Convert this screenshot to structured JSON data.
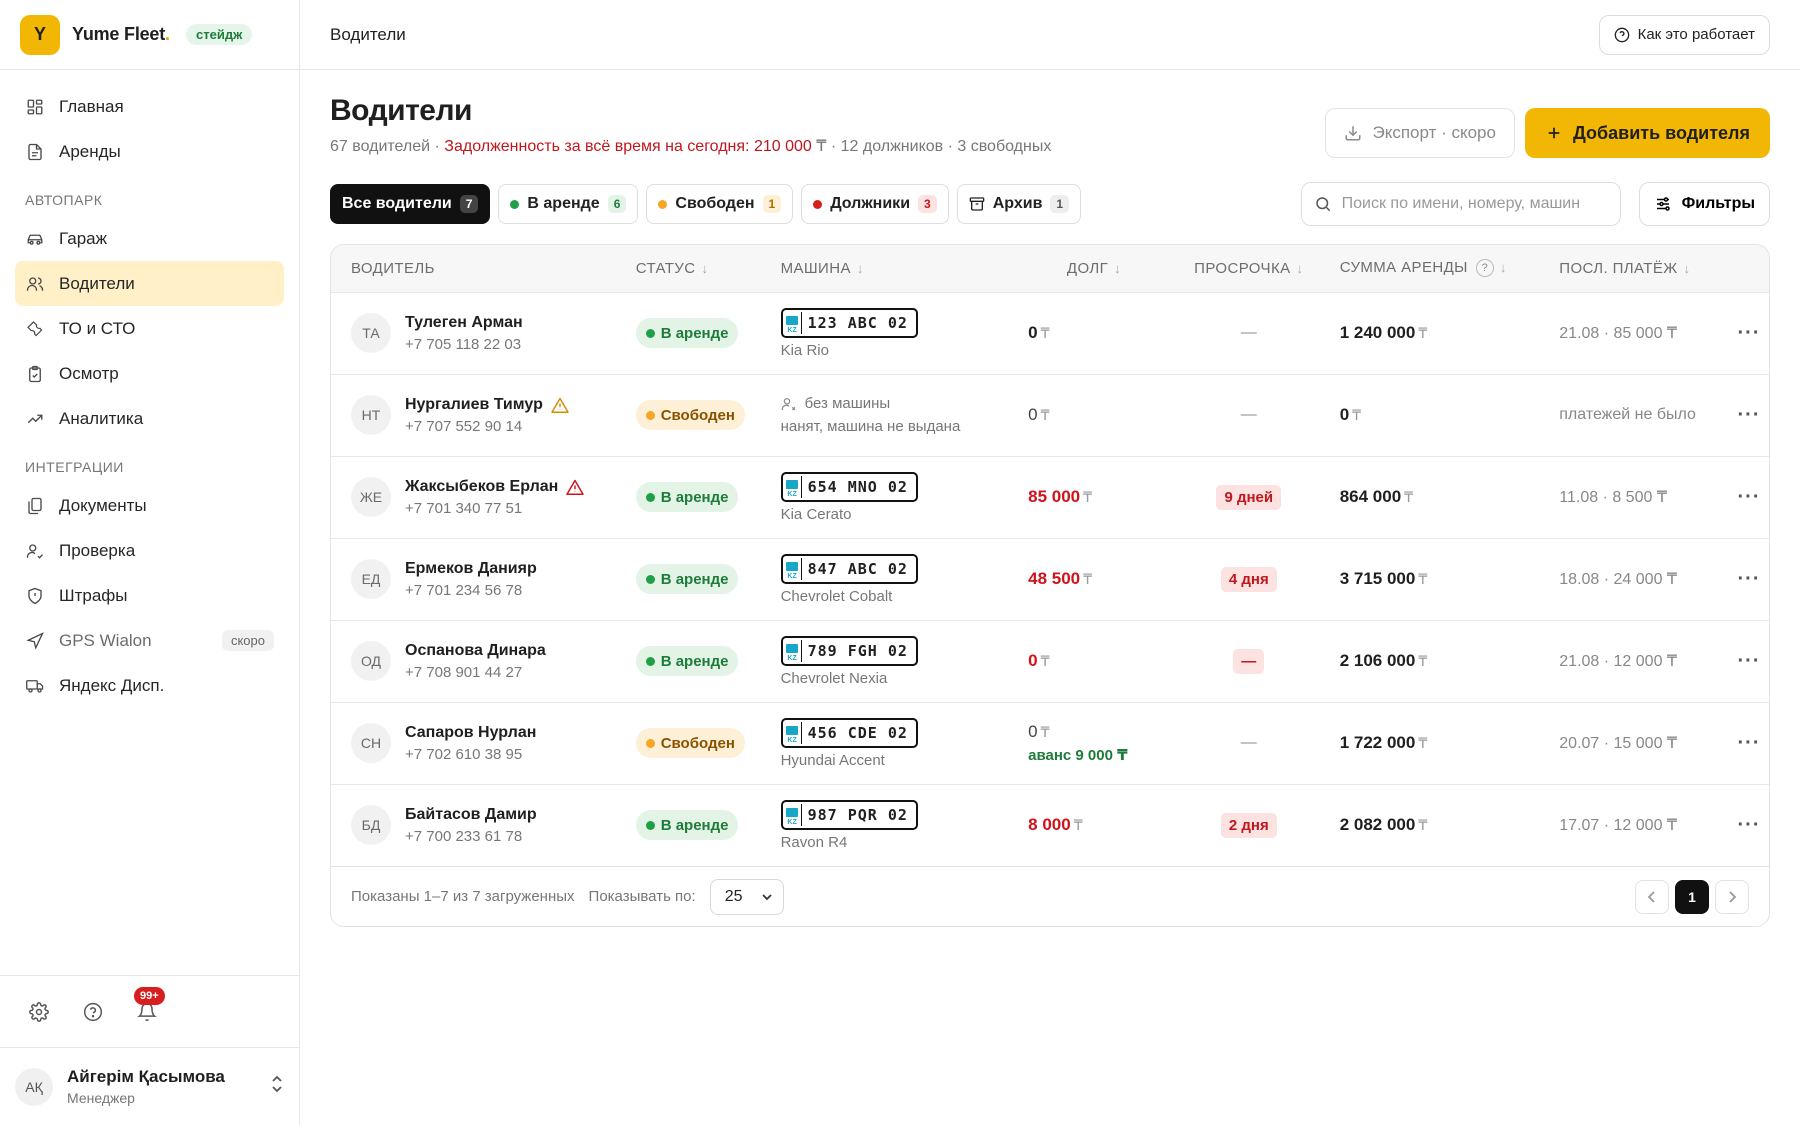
{
  "brand": {
    "logo_letter": "Y",
    "name": "Yume Fleet",
    "dot": ".",
    "badge": "стейдж"
  },
  "sidebar": {
    "items_main": [
      {
        "label": "Главная",
        "icon": "dashboard-icon"
      },
      {
        "label": "Аренды",
        "icon": "document-icon"
      }
    ],
    "section_fleet": "АВТОПАРК",
    "items_fleet": [
      {
        "label": "Гараж",
        "icon": "car-icon"
      },
      {
        "label": "Водители",
        "icon": "users-icon",
        "active": true
      },
      {
        "label": "ТО и СТО",
        "icon": "wrench-icon"
      },
      {
        "label": "Осмотр",
        "icon": "clipboard-icon"
      },
      {
        "label": "Аналитика",
        "icon": "trend-icon"
      }
    ],
    "section_integrations": "ИНТЕГРАЦИИ",
    "items_integrations": [
      {
        "label": "Документы",
        "icon": "documents-icon"
      },
      {
        "label": "Проверка",
        "icon": "user-check-icon"
      },
      {
        "label": "Штрафы",
        "icon": "shield-icon"
      },
      {
        "label": "GPS Wialon",
        "icon": "navigation-icon",
        "soon": "скоро"
      },
      {
        "label": "Яндекс Дисп.",
        "icon": "truck-icon"
      }
    ],
    "notifications_count": "99+",
    "user": {
      "initials": "AҚ",
      "name": "Айгерім Қасымова",
      "role": "Менеджер"
    }
  },
  "topbar": {
    "title": "Водители",
    "help_label": "Как это работает"
  },
  "page": {
    "title": "Водители",
    "subtitle_count": "67 водителей · ",
    "subtitle_debt": "Задолженность за всё время на сегодня: 210 000 ",
    "subtitle_debt_currency": "₸",
    "subtitle_rest": " · 12 должников · 3 свободных",
    "export_label": "Экспорт · скоро",
    "add_label": "Добавить водителя"
  },
  "filters": {
    "chips": [
      {
        "label": "Все водители",
        "count": "7",
        "dot": "",
        "active": true
      },
      {
        "label": "В аренде",
        "count": "6",
        "dot": "green"
      },
      {
        "label": "Свободен",
        "count": "1",
        "dot": "orange"
      },
      {
        "label": "Должники",
        "count": "3",
        "dot": "red"
      },
      {
        "label": "Архив",
        "count": "1",
        "dot": "archive"
      }
    ],
    "search_placeholder": "Поиск по имени, номеру, машин",
    "filters_label": "Фильтры"
  },
  "table": {
    "headers": {
      "driver": "ВОДИТЕЛЬ",
      "status": "СТАТУС",
      "car": "МАШИНА",
      "debt": "ДОЛГ",
      "overdue": "ПРОСРОЧКА",
      "rent_sum": "СУММА АРЕНДЫ",
      "last_payment": "ПОСЛ. ПЛАТЁЖ"
    },
    "currency": "₸",
    "rows": [
      {
        "initials": "ТА",
        "name": "Тулеген Арман",
        "phone": "+7 705 118 22 03",
        "warn": false,
        "status": "В аренде",
        "status_type": "rent",
        "plate": "123 ABC 02",
        "model": "Kia Rio",
        "debt": "0",
        "debt_style": "normal",
        "advance": "",
        "overdue": "—",
        "overdue_style": "dash",
        "rent_sum": "1 240 000",
        "last": "21.08 · 85 000 ₸"
      },
      {
        "initials": "НТ",
        "name": "Нургалиев Тимур",
        "phone": "+7 707 552 90 14",
        "warn": true,
        "status": "Свободен",
        "status_type": "free",
        "plate": "",
        "no_car": "без машины",
        "no_car_sub": "нанят, машина не выдана",
        "debt": "0",
        "debt_style": "plain",
        "advance": "",
        "overdue": "—",
        "overdue_style": "dash",
        "rent_sum": "0",
        "last": "платежей не было"
      },
      {
        "initials": "ЖЕ",
        "name": "Жаксыбеков Ерлан",
        "phone": "+7 701 340 77 51",
        "warn": true,
        "status": "В аренде",
        "status_type": "rent",
        "plate": "654 MNO 02",
        "model": "Kia Cerato",
        "debt": "85 000",
        "debt_style": "red",
        "advance": "",
        "overdue": "9 дней",
        "overdue_style": "badge",
        "rent_sum": "864 000",
        "last": "11.08 · 8 500 ₸"
      },
      {
        "initials": "ЕД",
        "name": "Ермеков Данияр",
        "phone": "+7 701 234 56 78",
        "warn": false,
        "status": "В аренде",
        "status_type": "rent",
        "plate": "847 ABC 02",
        "model": "Chevrolet Cobalt",
        "debt": "48 500",
        "debt_style": "red",
        "advance": "",
        "overdue": "4 дня",
        "overdue_style": "badge",
        "rent_sum": "3 715 000",
        "last": "18.08 · 24 000 ₸"
      },
      {
        "initials": "ОД",
        "name": "Оспанова Динара",
        "phone": "+7 708 901 44 27",
        "warn": false,
        "status": "В аренде",
        "status_type": "rent",
        "plate": "789 FGH 02",
        "model": "Chevrolet Nexia",
        "debt": "0",
        "debt_style": "red",
        "advance": "",
        "overdue": "—",
        "overdue_style": "badge",
        "rent_sum": "2 106 000",
        "last": "21.08 · 12 000 ₸"
      },
      {
        "initials": "СН",
        "name": "Сапаров Нурлан",
        "phone": "+7 702 610 38 95",
        "warn": false,
        "status": "Свободен",
        "status_type": "free",
        "plate": "456 CDE 02",
        "model": "Hyundai Accent",
        "debt": "0",
        "debt_style": "plain",
        "advance": "аванс 9 000 ₸",
        "overdue": "—",
        "overdue_style": "dash",
        "rent_sum": "1 722 000",
        "last": "20.07 · 15 000 ₸"
      },
      {
        "initials": "БД",
        "name": "Байтасов Дамир",
        "phone": "+7 700 233 61 78",
        "warn": false,
        "status": "В аренде",
        "status_type": "rent",
        "plate": "987 PQR 02",
        "model": "Ravon R4",
        "debt": "8 000",
        "debt_style": "red",
        "advance": "",
        "overdue": "2 дня",
        "overdue_style": "badge",
        "rent_sum": "2 082 000",
        "last": "17.07 · 12 000 ₸"
      }
    ]
  },
  "footer": {
    "shown": "Показаны 1–7 из 7 загруженных",
    "per_page_label": "Показывать по:",
    "per_page_value": "25",
    "current_page": "1"
  },
  "colors": {
    "accent": "#f2b705",
    "active_nav": "#fff0c7",
    "danger": "#d0131a",
    "success": "#1e7c3b"
  }
}
